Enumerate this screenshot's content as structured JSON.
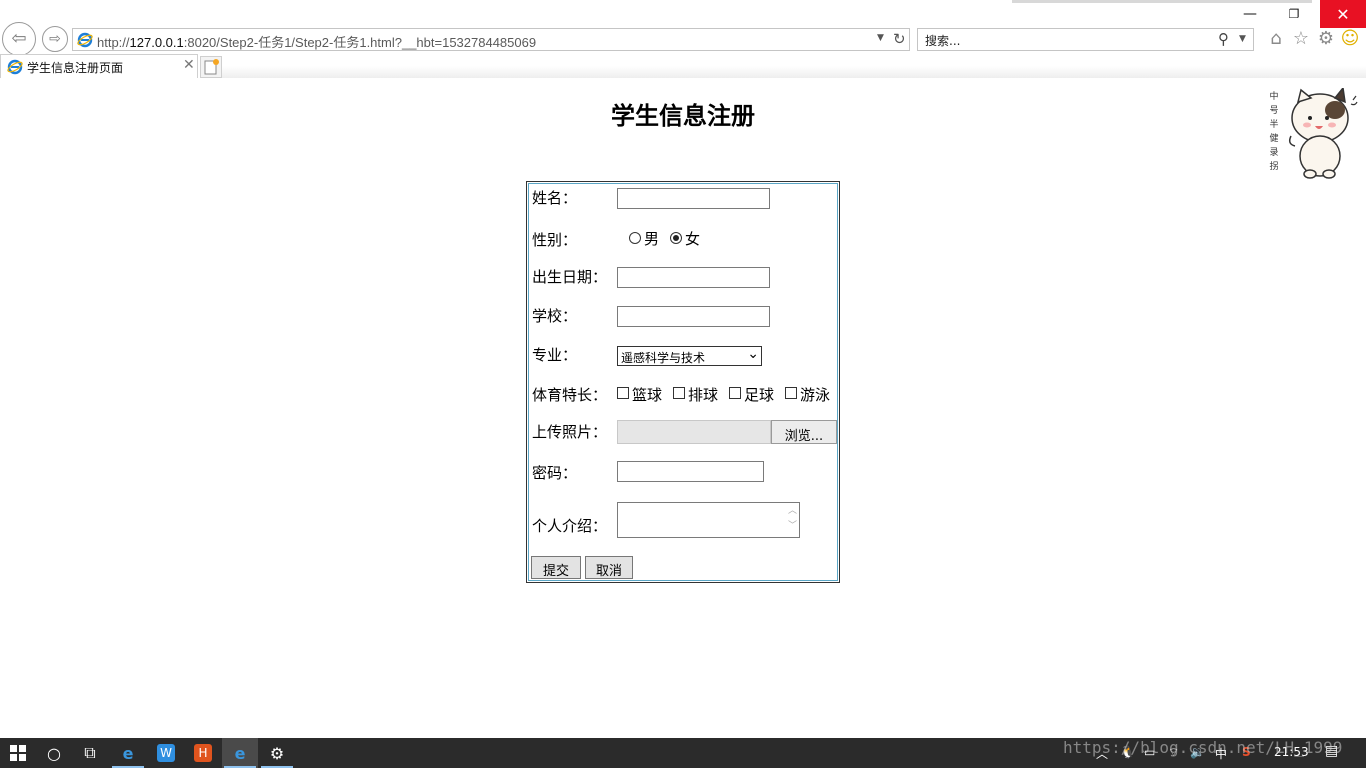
{
  "browser": {
    "url_prefix": "http://",
    "url_host": "127.0.0.1",
    "url_rest": ":8020/Step2-任务1/Step2-任务1.html?__hbt=1532784485069",
    "search_placeholder": "搜索...",
    "tab_title": "学生信息注册页面",
    "window_buttons": {
      "minimize": "—",
      "restore": "❐",
      "close": "✕"
    }
  },
  "page": {
    "title": "学生信息注册",
    "mascot_text": "中号半健录拐"
  },
  "form": {
    "name_label": "姓名：",
    "gender_label": "性别：",
    "gender_options": [
      "男",
      "女"
    ],
    "gender_selected": "女",
    "birth_label": "出生日期：",
    "school_label": "学校：",
    "major_label": "专业：",
    "major_selected": "遥感科学与技术",
    "sports_label": "体育特长：",
    "sports_options": [
      "篮球",
      "排球",
      "足球",
      "游泳"
    ],
    "photo_label": "上传照片：",
    "browse_button": "浏览...",
    "password_label": "密码：",
    "intro_label": "个人介绍：",
    "submit_button": "提交",
    "cancel_button": "取消"
  },
  "taskbar": {
    "tray_time": "21:53",
    "tray_ime": "中",
    "watermark": "https://blog.csdn.net/LH_1999"
  },
  "colors": {
    "close_red": "#e81123",
    "form_inner_border": "#5aa6c6",
    "taskbar_bg": "#2b2b2b"
  }
}
